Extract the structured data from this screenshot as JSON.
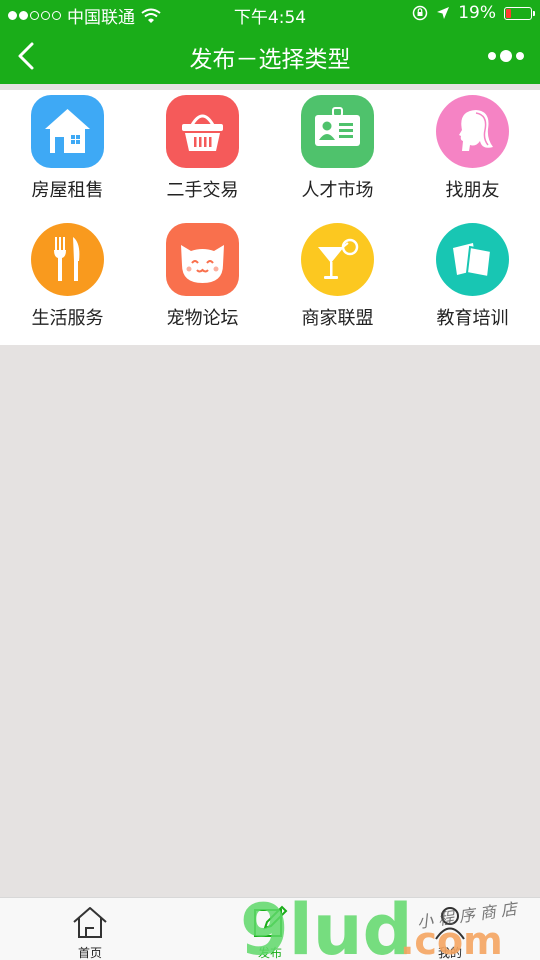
{
  "status": {
    "carrier": "中国联通",
    "time": "下午4:54",
    "battery": "19%",
    "battery_level": 0.19,
    "signal_bars": 2,
    "signal_total": 5
  },
  "nav": {
    "title": "发布－选择类型"
  },
  "categories": [
    {
      "label": "房屋租售",
      "icon": "house-icon",
      "color": "#3ea9f5"
    },
    {
      "label": "二手交易",
      "icon": "basket-icon",
      "color": "#f55a5a"
    },
    {
      "label": "人才市场",
      "icon": "id-card-icon",
      "color": "#4fc26c"
    },
    {
      "label": "找朋友",
      "icon": "woman-profile-icon",
      "color": "#f583c4"
    },
    {
      "label": "生活服务",
      "icon": "fork-knife-icon",
      "color": "#f99a1e"
    },
    {
      "label": "宠物论坛",
      "icon": "cat-icon",
      "color": "#f9704d"
    },
    {
      "label": "商家联盟",
      "icon": "cocktail-icon",
      "color": "#fcc820"
    },
    {
      "label": "教育培训",
      "icon": "cards-icon",
      "color": "#18c6b3"
    }
  ],
  "tabs": [
    {
      "label": "首页",
      "icon": "home-icon"
    },
    {
      "label": "发布",
      "icon": "edit-icon"
    },
    {
      "label": "我的",
      "icon": "user-icon"
    }
  ],
  "watermark": {
    "text": "9lud.com",
    "tagline": "小 程 序 商 店"
  },
  "colors": {
    "brand_green": "#1aad19",
    "background": "#e5e2e1"
  }
}
